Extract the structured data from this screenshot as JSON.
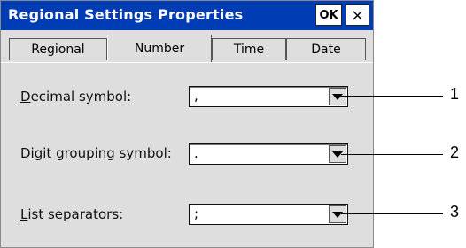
{
  "window": {
    "title": "Regional Settings Properties",
    "ok_label": "OK",
    "close_label": "×"
  },
  "tabs": [
    {
      "label": "Regional",
      "active": false
    },
    {
      "label": "Number",
      "active": true
    },
    {
      "label": "Time",
      "active": false
    },
    {
      "label": "Date",
      "active": false
    }
  ],
  "fields": {
    "decimal": {
      "label_first": "D",
      "label_rest": "ecimal symbol:",
      "value": ","
    },
    "grouping": {
      "label_pre": "Digit ",
      "label_key": "g",
      "label_post": "rouping symbol:",
      "value": "."
    },
    "list": {
      "label_first": "L",
      "label_rest": "ist separators:",
      "value": ";"
    }
  },
  "callouts": [
    "1",
    "2",
    "3"
  ]
}
